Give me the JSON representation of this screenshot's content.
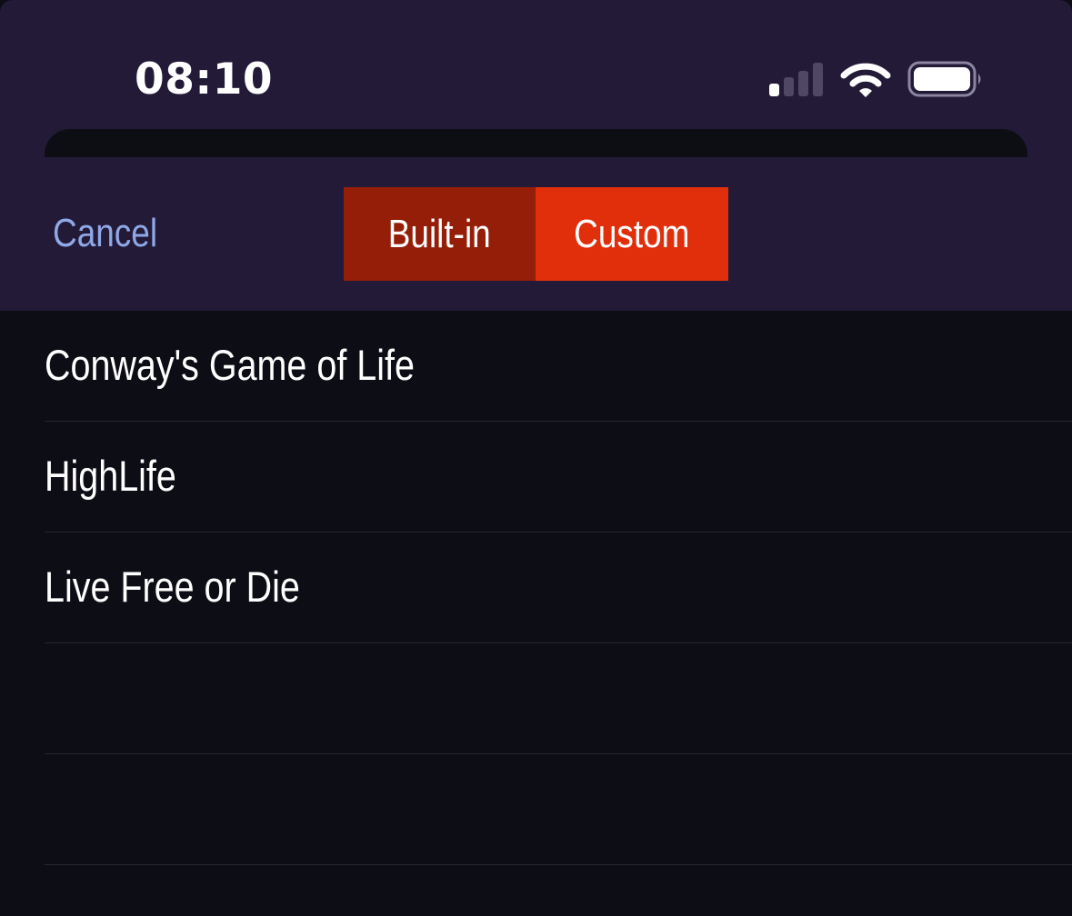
{
  "status_bar": {
    "time": "08:10",
    "icons": [
      "cellular-signal-icon",
      "wifi-icon",
      "battery-icon"
    ]
  },
  "nav": {
    "cancel_label": "Cancel",
    "segments": [
      {
        "label": "Built-in",
        "selected": false
      },
      {
        "label": "Custom",
        "selected": true
      }
    ]
  },
  "list": {
    "items": [
      {
        "label": "Conway's Game of Life"
      },
      {
        "label": "HighLife"
      },
      {
        "label": "Live Free or Die"
      },
      {
        "label": ""
      },
      {
        "label": ""
      }
    ]
  },
  "colors": {
    "header_background": "#231a38",
    "list_background": "#0d0d15",
    "segment_unselected": "#951e08",
    "segment_selected": "#e12e0b",
    "cancel_text": "#8fa8e6",
    "separator": "#26262f"
  }
}
